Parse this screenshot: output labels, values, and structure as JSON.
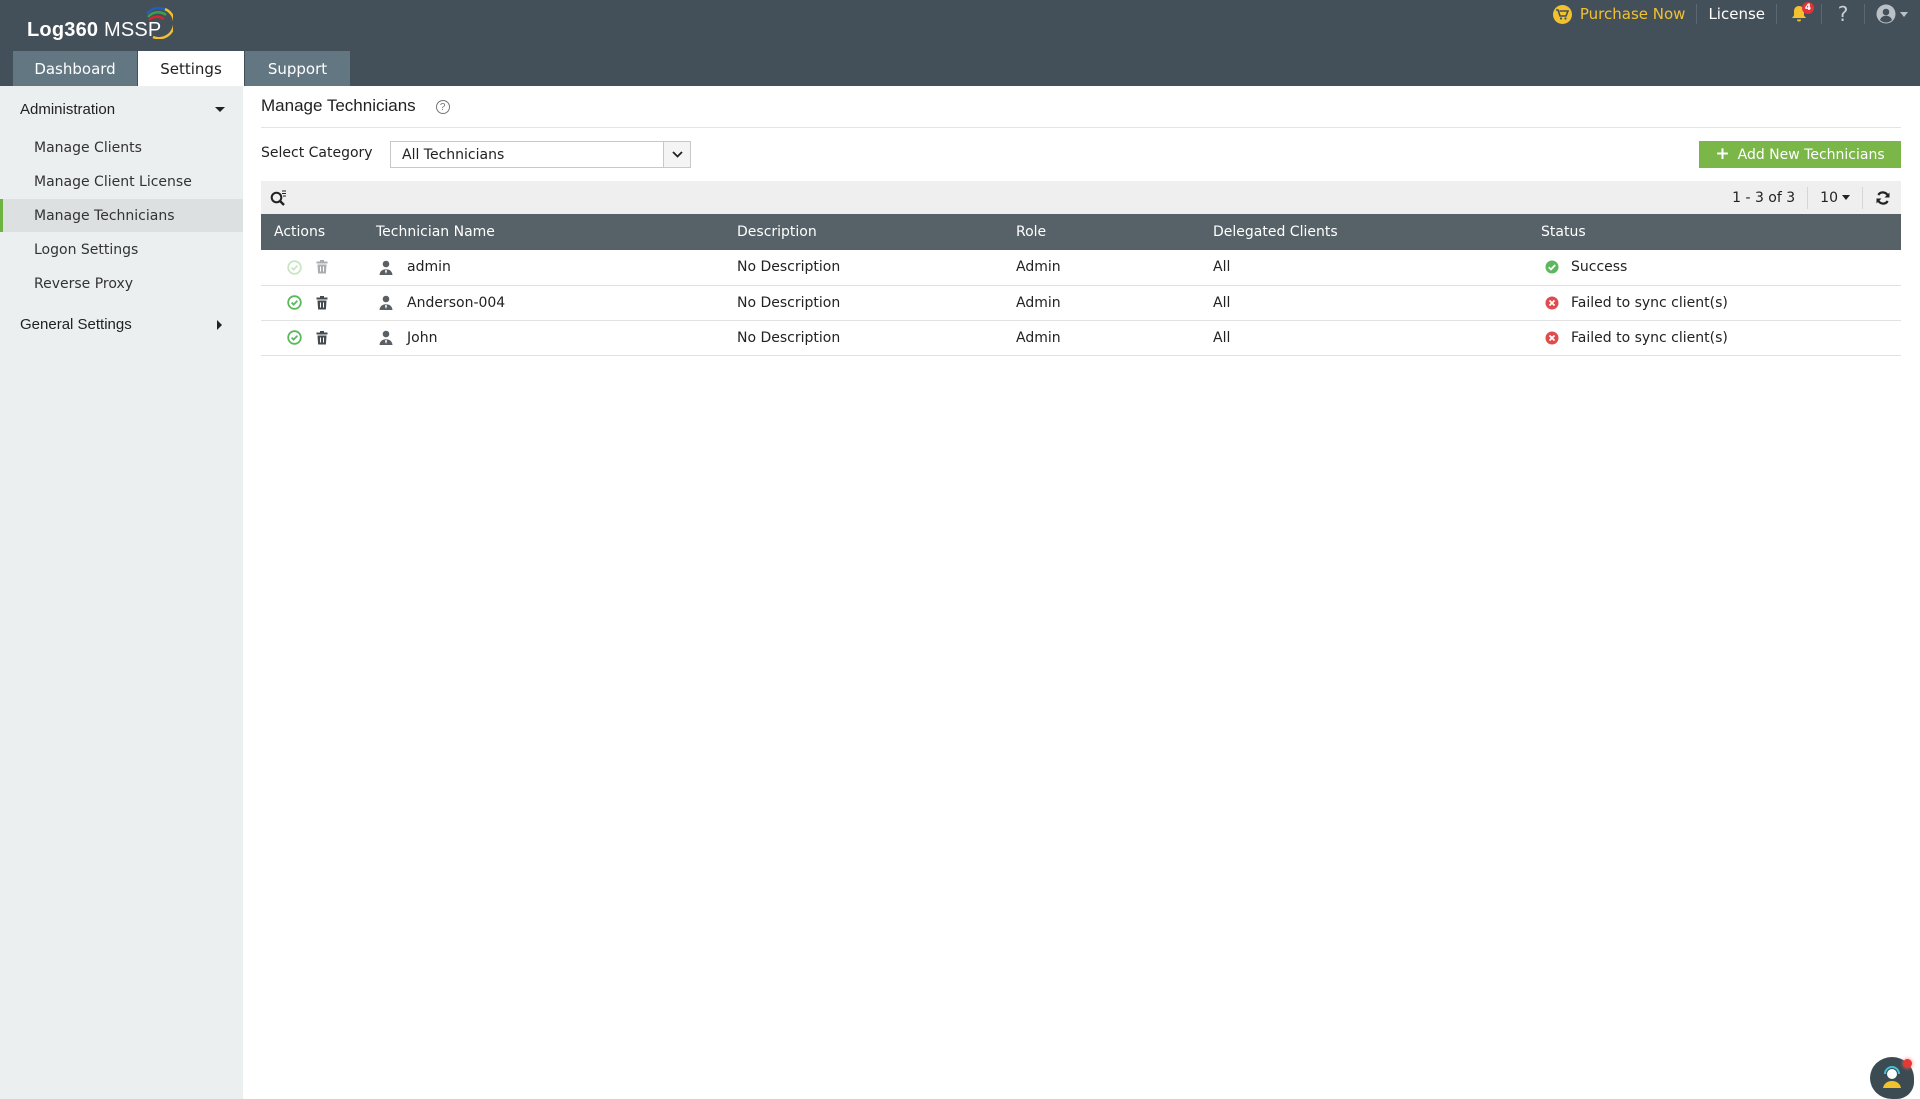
{
  "app": {
    "logo_bold": "Log360",
    "logo_light": " MSSP"
  },
  "header": {
    "tabs": [
      {
        "label": "Dashboard",
        "active": false
      },
      {
        "label": "Settings",
        "active": true
      },
      {
        "label": "Support",
        "active": false
      }
    ],
    "purchase_label": "Purchase Now",
    "license_label": "License",
    "notification_count": "4",
    "help_label": "?",
    "icons": {
      "cart": "cart-icon",
      "bell": "bell-icon",
      "help": "question-icon",
      "user": "user-circle-icon"
    },
    "colors": {
      "purchase": "#f2c12e",
      "badge": "#e0333a",
      "background": "#445059"
    }
  },
  "sidebar": {
    "groups": [
      {
        "label": "Administration",
        "expanded": true,
        "items": [
          {
            "label": "Manage Clients",
            "active": false
          },
          {
            "label": "Manage Client License",
            "active": false
          },
          {
            "label": "Manage Technicians",
            "active": true
          },
          {
            "label": "Logon Settings",
            "active": false
          },
          {
            "label": "Reverse Proxy",
            "active": false
          }
        ]
      },
      {
        "label": "General Settings",
        "expanded": false,
        "items": []
      }
    ],
    "active_accent": "#6cb33f"
  },
  "main": {
    "title": "Manage Technicians",
    "help_icon": "?",
    "category": {
      "label": "Select Category",
      "selected": "All Technicians"
    },
    "add_button": {
      "label": "Add New Technicians",
      "color": "#7ab648"
    },
    "pagination": {
      "range": "1 - 3 of 3",
      "per_page": "10"
    },
    "table": {
      "columns": [
        "Actions",
        "Technician Name",
        "Description",
        "Role",
        "Delegated Clients",
        "Status"
      ],
      "rows": [
        {
          "name": "admin",
          "description": "No Description",
          "role": "Admin",
          "delegated": "All",
          "status": "Success",
          "status_type": "success",
          "actions_enabled": false
        },
        {
          "name": "Anderson-004",
          "description": "No Description",
          "role": "Admin",
          "delegated": "All",
          "status": "Failed to sync client(s)",
          "status_type": "error",
          "actions_enabled": true
        },
        {
          "name": "John",
          "description": "No Description",
          "role": "Admin",
          "delegated": "All",
          "status": "Failed to sync client(s)",
          "status_type": "error",
          "actions_enabled": true
        }
      ]
    },
    "status_colors": {
      "success": "#5cb85c",
      "error": "#e04b4b"
    }
  }
}
